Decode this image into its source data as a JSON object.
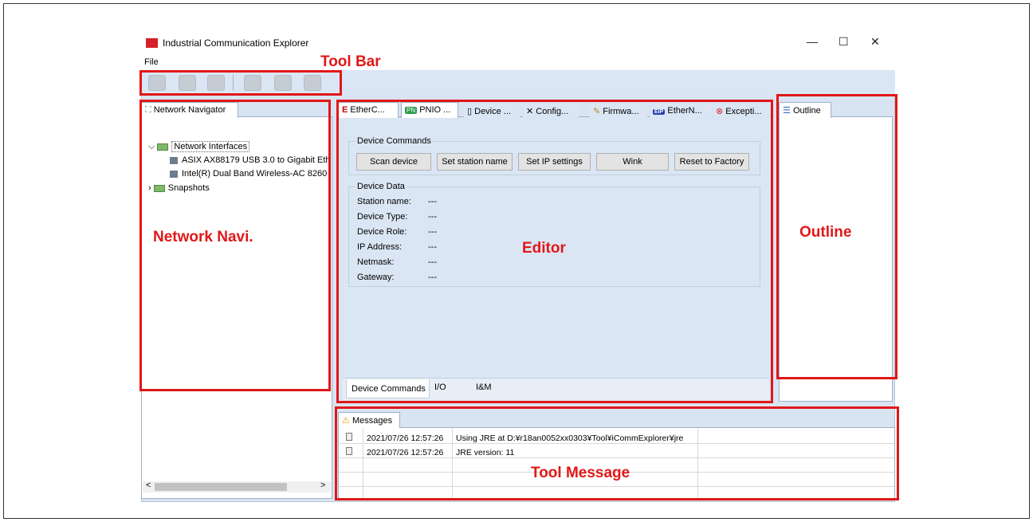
{
  "app": {
    "title": "Industrial Communication Explorer",
    "minimize": "—",
    "maximize": "☐",
    "close": "✕"
  },
  "menu": {
    "file": "File"
  },
  "navigator": {
    "tab": "Network Navigator",
    "tree": {
      "root": "Network Interfaces",
      "items": [
        "ASIX AX88179 USB 3.0 to Gigabit Eth",
        "Intel(R) Dual Band Wireless-AC 8260"
      ],
      "snapshots": "Snapshots"
    }
  },
  "editor": {
    "tabs": [
      "EtherC...",
      "PNIO ...",
      "Device ...",
      "Config...",
      "Firmwa...",
      "EtherN...",
      "Excepti..."
    ],
    "tab_badges": {
      "pnio": "PN",
      "ethernet": "EIP"
    },
    "device_commands_title": "Device Commands",
    "buttons": [
      "Scan device",
      "Set station name",
      "Set IP settings",
      "Wink",
      "Reset to Factory"
    ],
    "device_data_title": "Device Data",
    "fields": [
      {
        "label": "Station name:",
        "value": "---"
      },
      {
        "label": "Device Type:",
        "value": "---"
      },
      {
        "label": "Device Role:",
        "value": "---"
      },
      {
        "label": "IP Address:",
        "value": "---"
      },
      {
        "label": "Netmask:",
        "value": "---"
      },
      {
        "label": "Gateway:",
        "value": "---"
      }
    ],
    "bottom_tabs": [
      "Device Commands",
      "I/O",
      "I&M"
    ]
  },
  "outline": {
    "tab": "Outline"
  },
  "messages": {
    "tab": "Messages",
    "rows": [
      {
        "time": "2021/07/26 12:57:26",
        "text": "Using JRE at D:¥r18an0052xx0303¥Tool¥iCommExplorer¥jre"
      },
      {
        "time": "2021/07/26 12:57:26",
        "text": "JRE version: 11"
      }
    ]
  },
  "annotations": {
    "toolbar": "Tool Bar",
    "network": "Network Navi.",
    "editor": "Editor",
    "outline": "Outline",
    "messages": "Tool Message"
  },
  "scroll": {
    "left": "<",
    "right": ">"
  },
  "colors": {
    "annotation": "#e01818",
    "window_bg": "#d9e4f2"
  }
}
